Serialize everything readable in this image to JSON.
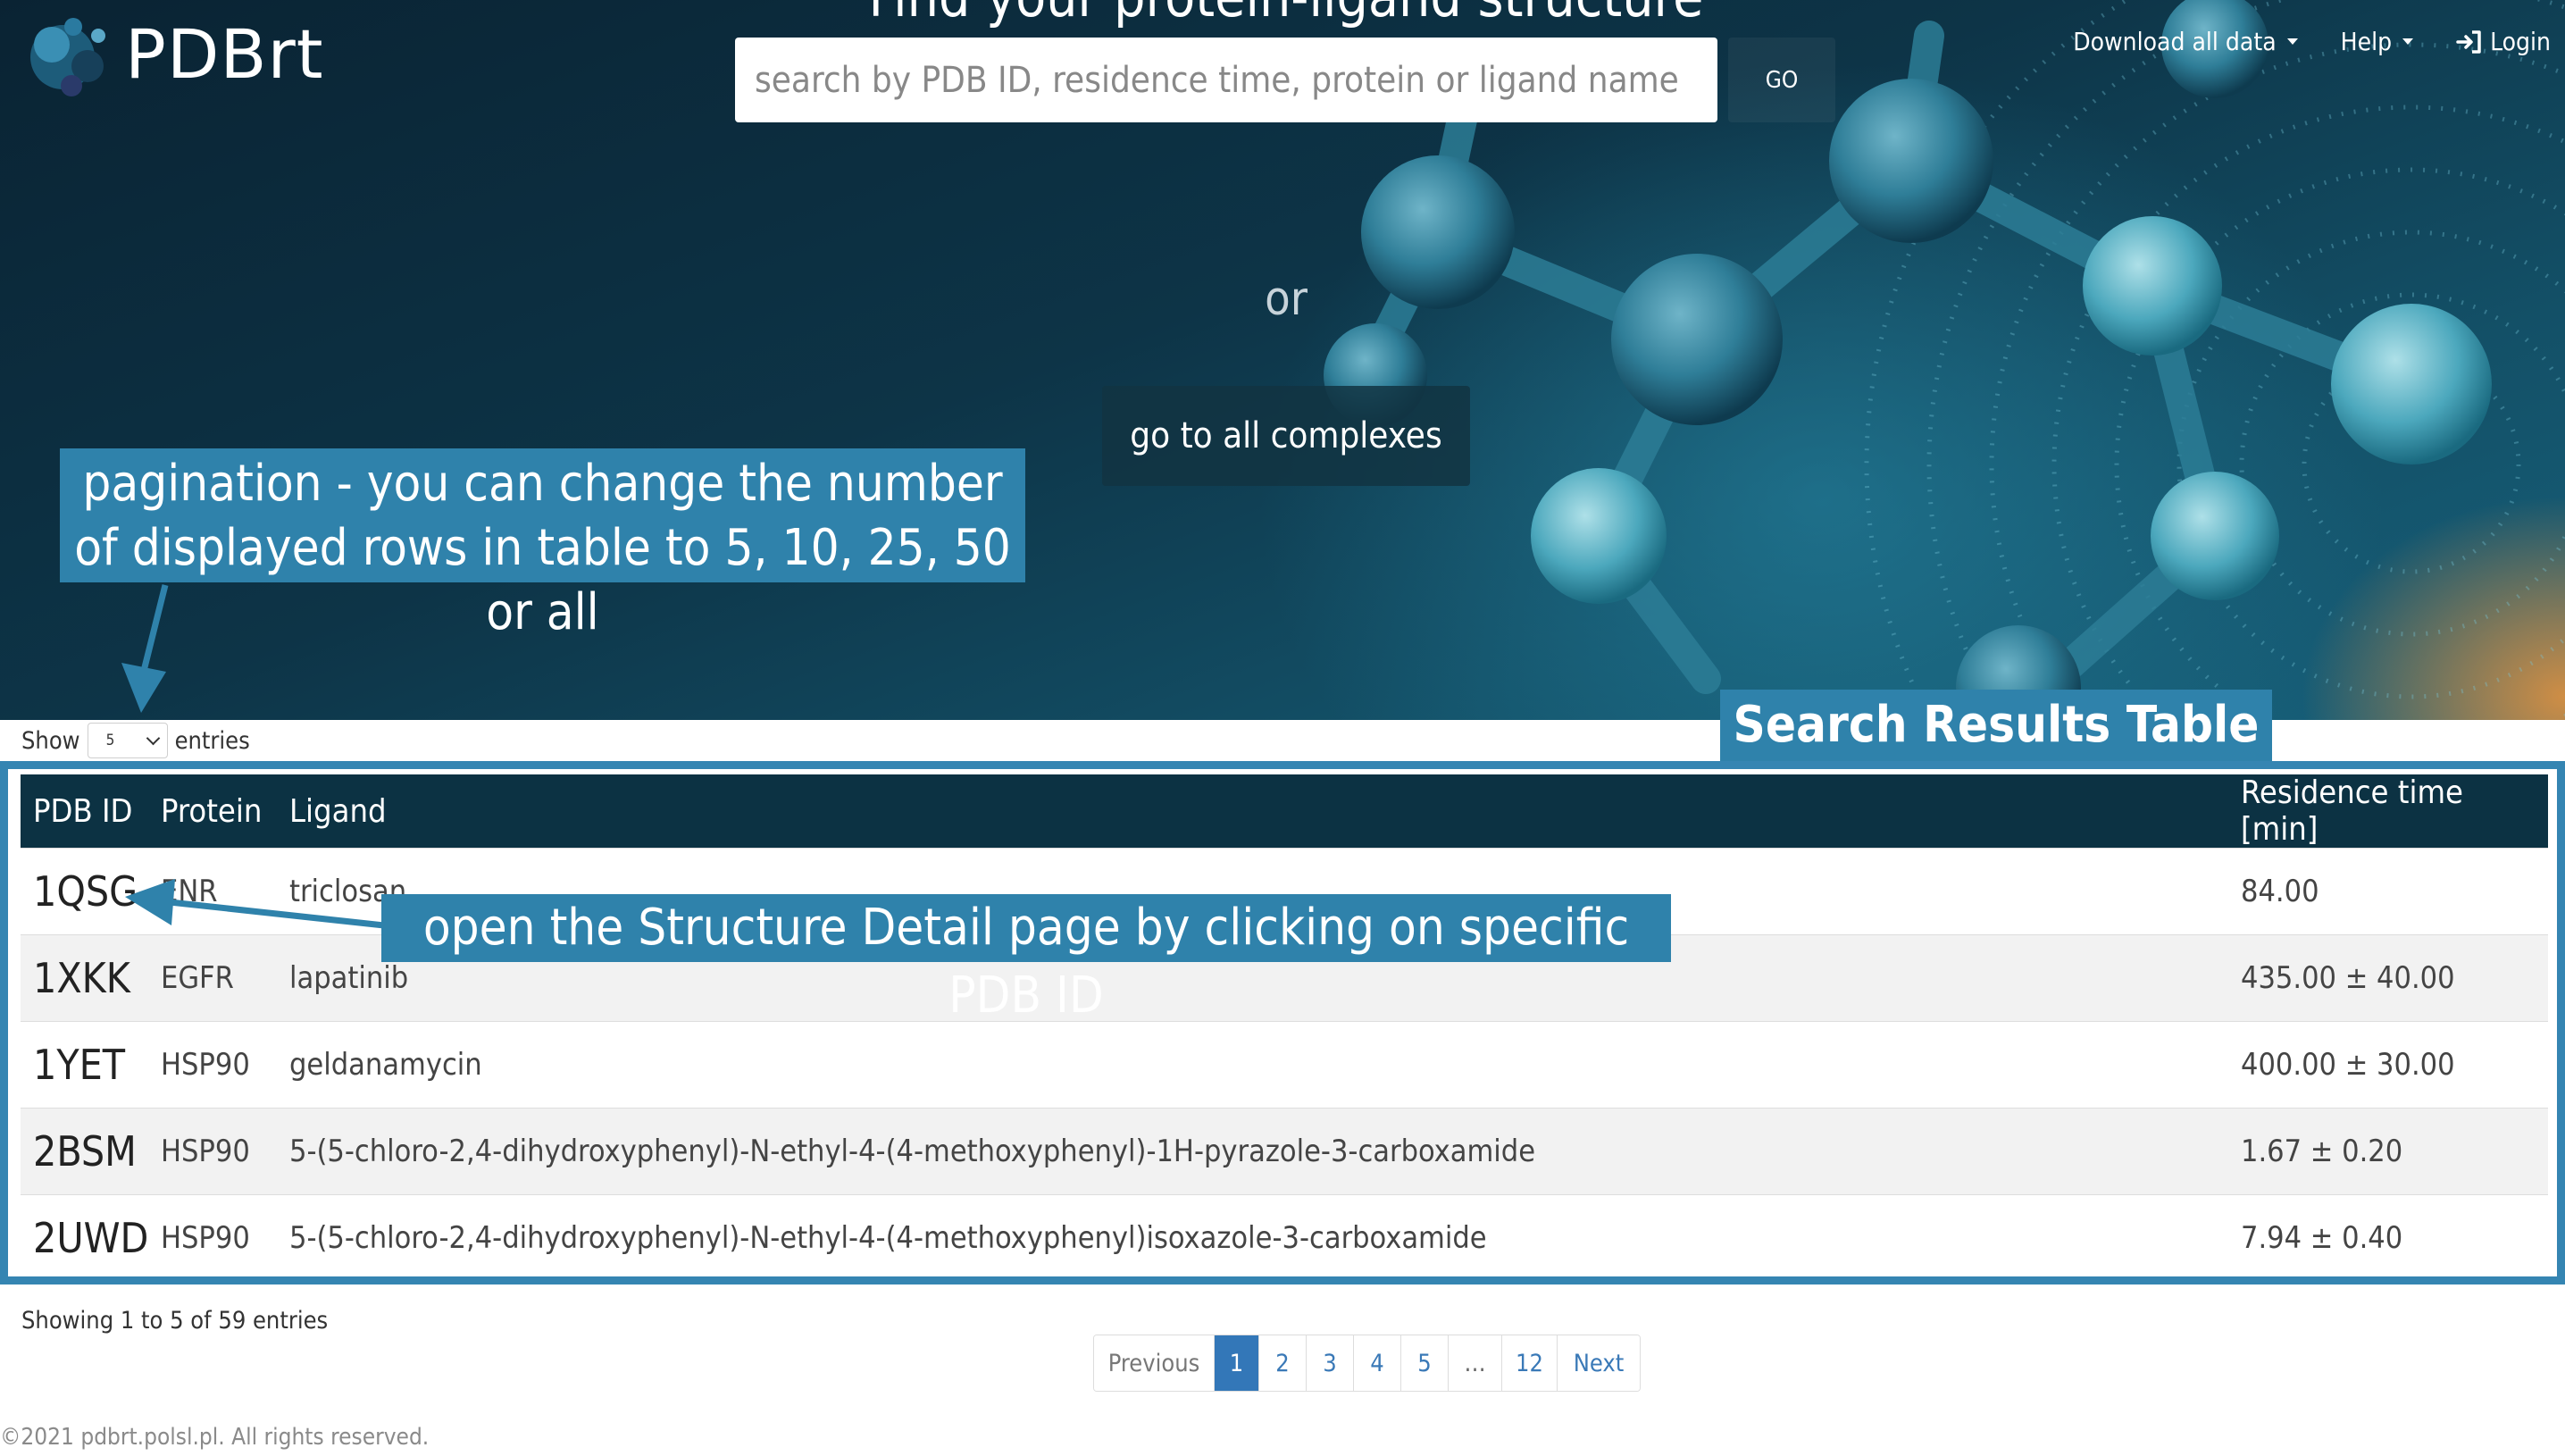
{
  "app": {
    "logo_text": "PDBrt",
    "hero_title": "Find your protein-ligand structure"
  },
  "search": {
    "placeholder": "search by PDB ID, residence time, protein or ligand name",
    "value": "",
    "go_label": "GO"
  },
  "nav": {
    "download_label": "Download all data",
    "help_label": "Help",
    "login_label": "Login"
  },
  "hero": {
    "or_text": "or",
    "all_complexes_label": "go to all complexes"
  },
  "annotations": {
    "pagination": "pagination - you can change the number of displayed rows in table to 5, 10, 25, 50 or all",
    "results_table": "Search Results Table",
    "detail": "open the Structure Detail page by clicking on specific PDB ID"
  },
  "table_controls": {
    "show_label": "Show",
    "page_size": "5",
    "entries_label": "entries"
  },
  "table": {
    "columns": [
      "PDB ID",
      "Protein",
      "Ligand",
      "Residence time [min]"
    ],
    "rows": [
      {
        "pdb_id": "1QSG",
        "protein": "ENR",
        "ligand": "triclosan",
        "residence_time": "84.00"
      },
      {
        "pdb_id": "1XKK",
        "protein": "EGFR",
        "ligand": "lapatinib",
        "residence_time": "435.00 ± 40.00"
      },
      {
        "pdb_id": "1YET",
        "protein": "HSP90",
        "ligand": "geldanamycin",
        "residence_time": "400.00 ± 30.00"
      },
      {
        "pdb_id": "2BSM",
        "protein": "HSP90",
        "ligand": "5-(5-chloro-2,4-dihydroxyphenyl)-N-ethyl-4-(4-methoxyphenyl)-1H-pyrazole-3-carboxamide",
        "residence_time": "1.67 ± 0.20"
      },
      {
        "pdb_id": "2UWD",
        "protein": "HSP90",
        "ligand": "5-(5-chloro-2,4-dihydroxyphenyl)-N-ethyl-4-(4-methoxyphenyl)isoxazole-3-carboxamide",
        "residence_time": "7.94 ± 0.40"
      }
    ]
  },
  "footer": {
    "showing_text": "Showing 1 to 5 of 59 entries",
    "pagination": {
      "previous": "Previous",
      "pages": [
        "1",
        "2",
        "3",
        "4",
        "5",
        "…",
        "12"
      ],
      "active_page": "1",
      "next": "Next"
    },
    "copyright": "©2021 pdbrt.polsl.pl. All rights reserved."
  },
  "colors": {
    "callout": "#2f82ab",
    "table_header": "#0c3243",
    "table_frame": "#3585b2",
    "active_page": "#3377b8"
  },
  "icons": {
    "login": "login-icon",
    "dropdown": "caret-down-icon"
  }
}
